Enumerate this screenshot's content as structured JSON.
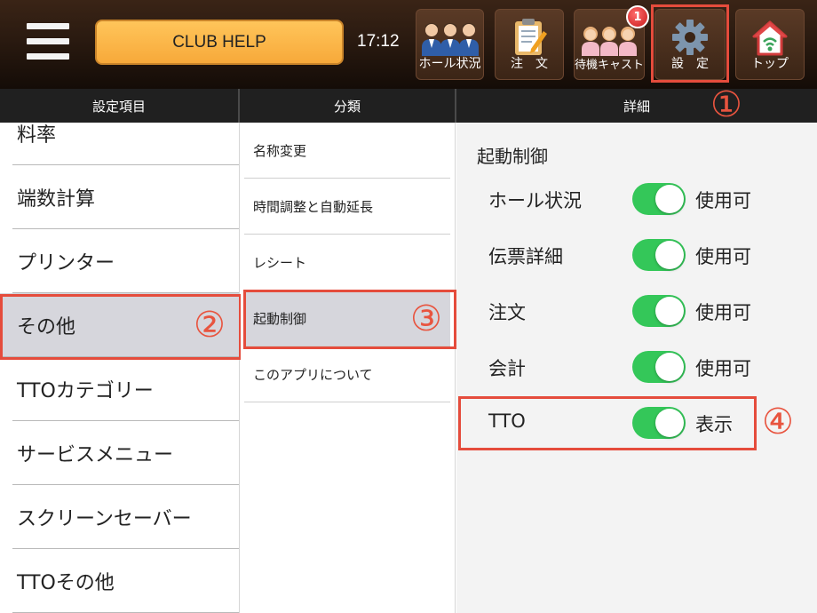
{
  "header": {
    "club_button": "CLUB HELP",
    "clock": "17:12",
    "nav": {
      "hall": "ホール状況",
      "order": "注　文",
      "cast": "待機キャスト",
      "cast_badge": "1",
      "settings": "設　定",
      "top": "トップ"
    }
  },
  "columns": {
    "col1": "設定項目",
    "col2": "分類",
    "col3": "詳細"
  },
  "annotations": {
    "n1": "①",
    "n2": "②",
    "n3": "③",
    "n4": "④",
    "color": "#e54c3c"
  },
  "settings_items": [
    "料率",
    "端数計算",
    "プリンター",
    "その他",
    "TTOカテゴリー",
    "サービスメニュー",
    "スクリーンセーバー",
    "TTOその他"
  ],
  "categories": [
    "名称変更",
    "時間調整と自動延長",
    "レシート",
    "起動制御",
    "このアプリについて"
  ],
  "detail": {
    "title": "起動制御",
    "rows": [
      {
        "label": "ホール状況",
        "state": "使用可",
        "on": true
      },
      {
        "label": "伝票詳細",
        "state": "使用可",
        "on": true
      },
      {
        "label": "注文",
        "state": "使用可",
        "on": true
      },
      {
        "label": "会計",
        "state": "使用可",
        "on": true
      },
      {
        "label": "TTO",
        "state": "表示",
        "on": true
      }
    ]
  },
  "colors": {
    "toggle_on": "#34c759",
    "selected_row": "#d6d6dc",
    "header_bg": "#2a1a10"
  }
}
